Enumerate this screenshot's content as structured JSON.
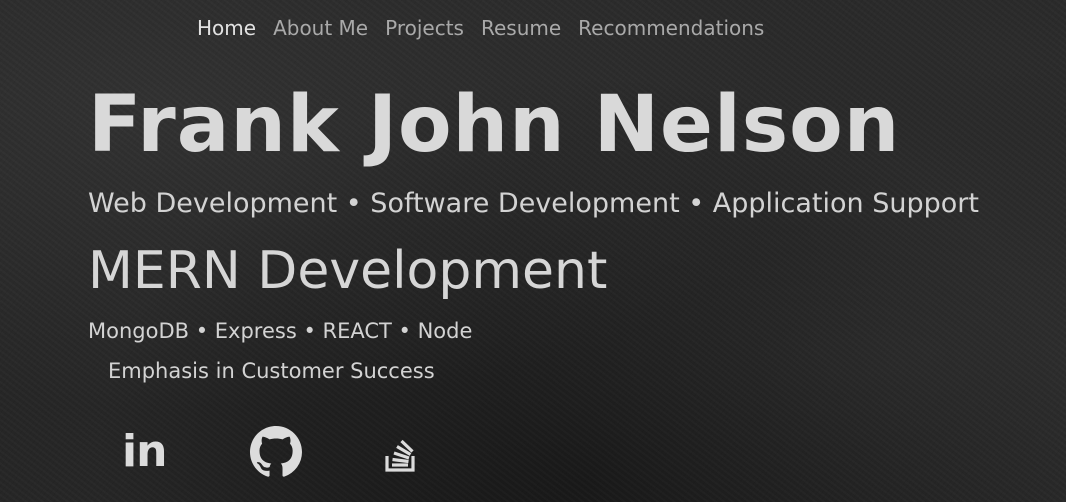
{
  "nav": {
    "items": [
      {
        "label": "Home",
        "active": true
      },
      {
        "label": "About Me",
        "active": false
      },
      {
        "label": "Projects",
        "active": false
      },
      {
        "label": "Resume",
        "active": false
      },
      {
        "label": "Recommendations",
        "active": false
      }
    ]
  },
  "hero": {
    "name": "Frank John Nelson",
    "services": "Web Development • Software Development • Application Support",
    "specialty": "MERN Development",
    "stack": "MongoDB • Express • REACT • Node",
    "emphasis": "Emphasis in Customer Success"
  },
  "social": [
    {
      "icon": "linkedin-icon",
      "text": "in"
    },
    {
      "icon": "github-icon"
    },
    {
      "icon": "stackoverflow-icon"
    }
  ],
  "colors": {
    "background": "#262626",
    "text": "#d6d6d6",
    "nav_inactive": "#a9a9a9",
    "nav_active": "#e2e2e2"
  }
}
